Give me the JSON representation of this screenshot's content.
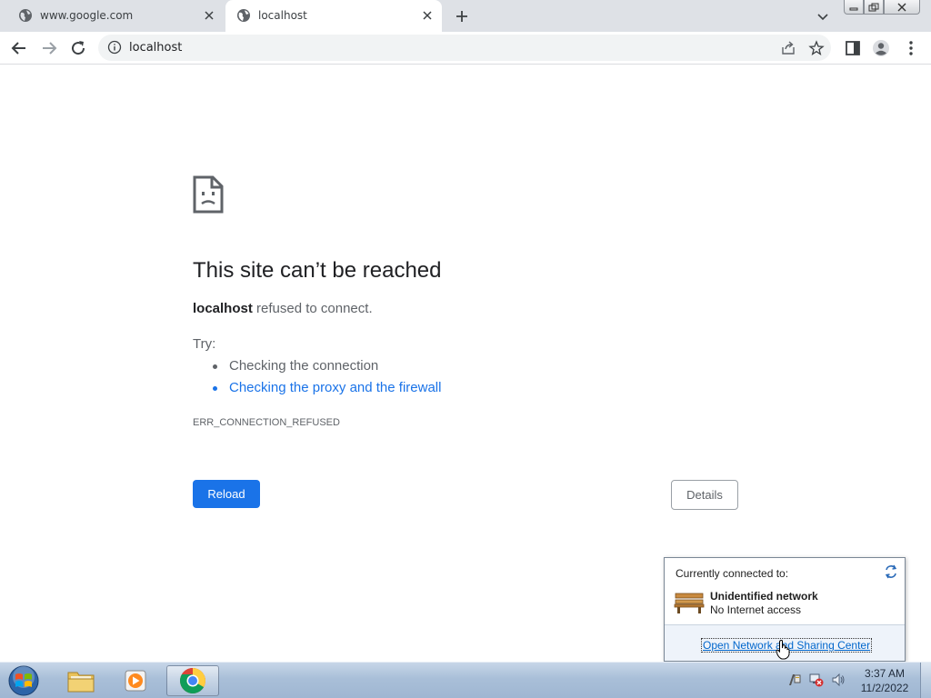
{
  "tabs": [
    {
      "title": "www.google.com",
      "active": false
    },
    {
      "title": "localhost",
      "active": true
    }
  ],
  "omnibox": {
    "url": "localhost"
  },
  "error": {
    "title": "This site can’t be reached",
    "host": "localhost",
    "desc_rest": " refused to connect.",
    "try_label": "Try:",
    "suggestions": [
      "Checking the connection",
      "Checking the proxy and the firewall"
    ],
    "code": "ERR_CONNECTION_REFUSED",
    "reload_label": "Reload",
    "details_label": "Details"
  },
  "flyout": {
    "header": "Currently connected to:",
    "network_name": "Unidentified network",
    "network_status": "No Internet access",
    "link": "Open Network and Sharing Center"
  },
  "taskbar": {
    "time": "3:37 AM",
    "date": "11/2/2022"
  },
  "colors": {
    "accent": "#1a73e8",
    "tabstrip": "#dee1e6",
    "taskbar": "#a9bfd8"
  },
  "icons": [
    "globe-icon",
    "close-icon",
    "plus-icon",
    "chevron-down-icon",
    "back-arrow-icon",
    "forward-arrow-icon",
    "reload-icon",
    "info-icon",
    "share-icon",
    "star-icon",
    "side-panel-icon",
    "profile-icon",
    "kebab-menu-icon",
    "sad-page-icon",
    "bench-network-icon",
    "refresh-icon",
    "hand-cursor-icon",
    "windows-start-icon",
    "folder-icon",
    "media-player-icon",
    "chrome-icon",
    "action-center-icon",
    "network-error-icon",
    "speaker-icon"
  ]
}
